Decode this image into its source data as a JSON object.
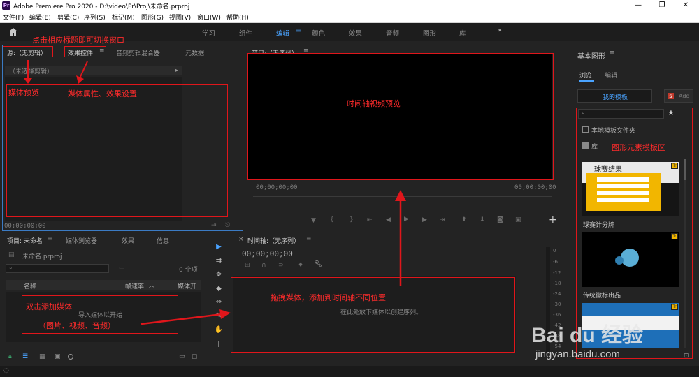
{
  "window": {
    "app_icon": "Pr",
    "title": "Adobe Premiere Pro 2020 - D:\\video\\Pr\\Proj\\未命名.prproj",
    "controls": [
      "—",
      "❐",
      "✕"
    ]
  },
  "menu": [
    "文件(F)",
    "编辑(E)",
    "剪辑(C)",
    "序列(S)",
    "标记(M)",
    "图形(G)",
    "视图(V)",
    "窗口(W)",
    "帮助(H)"
  ],
  "workspaces": {
    "items": [
      "学习",
      "组件",
      "编辑",
      "颜色",
      "效果",
      "音频",
      "图形",
      "库"
    ],
    "active": "编辑",
    "more": "»"
  },
  "source_panel": {
    "tabs": [
      "源:（无剪辑）",
      "效果控件",
      "音频剪辑混合器",
      "元数据"
    ],
    "clip_selector": "（未选择剪辑）",
    "timecode": "00;00;00;00"
  },
  "program_panel": {
    "title": "节目:（无序列）",
    "timecode_left": "00;00;00;00",
    "timecode_right": "00;00;00;00",
    "add_button": "+"
  },
  "project_panel": {
    "tabs": [
      "项目: 未命名",
      "媒体浏览器",
      "效果",
      "信息"
    ],
    "project_file": "未命名.prproj",
    "item_count": "0 个项",
    "columns": [
      "名称",
      "帧速率",
      "媒体开"
    ],
    "import_hint": "导入媒体以开始"
  },
  "timeline_panel": {
    "title": "时间轴:（无序列）",
    "timecode": "00;00;00;00",
    "drop_hint": "在此处放下媒体以创建序列。"
  },
  "tools": [
    "▶",
    "⇉",
    "✥",
    "◆",
    "⇔",
    "✎",
    "✋",
    "T"
  ],
  "audio_meter": {
    "ticks": [
      "0",
      "-6",
      "-12",
      "-18",
      "-24",
      "-30",
      "-36",
      "-42",
      "-48",
      "-54"
    ]
  },
  "graphics_panel": {
    "title": "基本图形",
    "tabs": [
      "浏览",
      "编辑"
    ],
    "active_tab": "浏览",
    "my_templates": "我的模板",
    "adobe_stock": "Ado",
    "local_folder": "本地模板文件夹",
    "library": "库",
    "templates": [
      {
        "name": "球赛计分牌",
        "thumb_title": "球赛结果"
      },
      {
        "name": "传统徽标出品",
        "thumb_title": ""
      }
    ]
  },
  "annotations": {
    "switch_hint": "点击相应标题即可切换窗口",
    "media_preview": "媒体预览",
    "effect_settings": "媒体属性、效果设置",
    "timeline_preview": "时间轴视频预览",
    "graphics_area": "图形元素模板区",
    "drag_hint": "拖拽媒体，添加到时间轴不同位置",
    "double_click": "双击添加媒体",
    "media_types": "（图片、视频、音频）"
  },
  "watermark": {
    "brand": "Bai du 经验",
    "url": "jingyan.baidu.com"
  },
  "colors": {
    "annotation_red": "#e0161b",
    "accent_blue": "#4aa3ff",
    "panel_bg": "#232323"
  }
}
